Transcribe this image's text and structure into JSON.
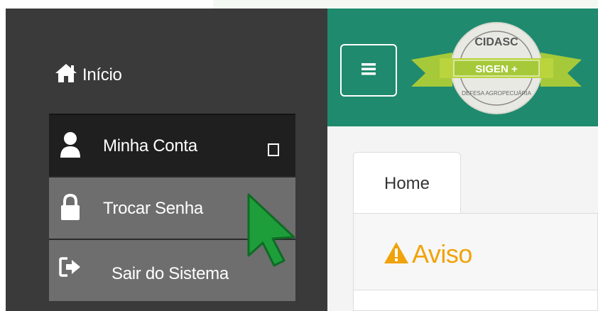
{
  "sidebar": {
    "items": [
      {
        "label": "Início",
        "icon": "home-icon"
      },
      {
        "label": "Minha Conta",
        "icon": "user-icon"
      },
      {
        "label": "Trocar Senha",
        "icon": "lock-icon"
      },
      {
        "label": "Sair do Sistema",
        "icon": "sign-out-icon"
      }
    ]
  },
  "header": {
    "logo": {
      "top_text": "CIDASC",
      "banner_text": "SIGEN +",
      "bottom_text": "DEFESA AGROPECUÁRIA"
    },
    "menu_icon": "hamburger-icon"
  },
  "tabs": [
    {
      "label": "Home",
      "active": true
    }
  ],
  "panel": {
    "title": "Aviso",
    "icon": "warning-icon"
  },
  "colors": {
    "sidebar_bg": "#3a3a3a",
    "active_item_bg": "#1f1f1f",
    "submenu_bg": "#6e6e6e",
    "header_green": "#1f8a6e",
    "warning_orange": "#f0a30a",
    "cursor_green": "#1e9e3a"
  }
}
